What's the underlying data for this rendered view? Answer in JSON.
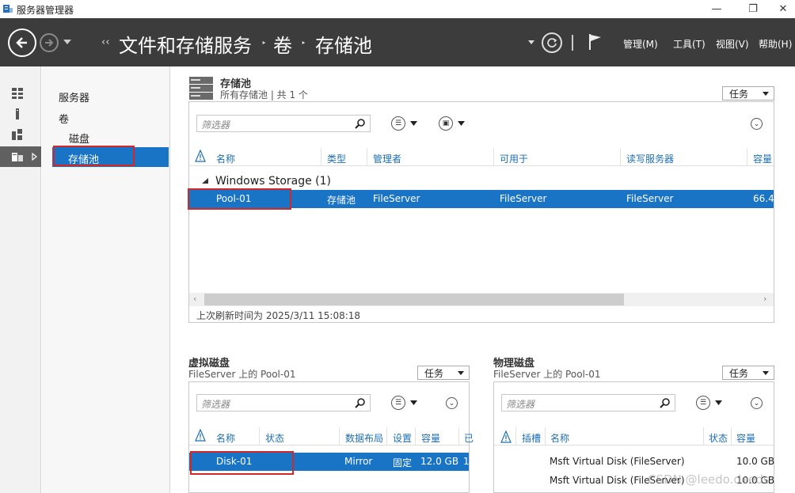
{
  "window": {
    "title": "服务器管理器",
    "minimize": "—",
    "restore": "❐",
    "close": "✕"
  },
  "header": {
    "breadcrumb_prefix": "‹‹",
    "breadcrumb": [
      "文件和存储服务",
      "卷",
      "存储池"
    ],
    "breadcrumb_sep": "‣",
    "menus": [
      "管理(M)",
      "工具(T)",
      "视图(V)",
      "帮助(H)"
    ]
  },
  "nav": {
    "items": [
      "服务器",
      "卷",
      "磁盘",
      "存储池"
    ]
  },
  "pools": {
    "title": "存储池",
    "subtitle": "所有存储池 | 共 1 个",
    "tasks": "任务",
    "filter_placeholder": "筛选器",
    "columns": [
      "名称",
      "类型",
      "管理者",
      "可用于",
      "读写服务器",
      "容量"
    ],
    "group": "Windows Storage (1)",
    "rows": [
      {
        "name": "Pool-01",
        "type": "存储池",
        "managed_by": "FileServer",
        "available_to": "FileServer",
        "rw_server": "FileServer",
        "capacity": "66.4"
      }
    ],
    "footer": "上次刷新时间为 2025/3/11 15:08:18"
  },
  "vdisks": {
    "title": "虚拟磁盘",
    "subtitle": "FileServer 上的 Pool-01",
    "tasks": "任务",
    "filter_placeholder": "筛选器",
    "columns": [
      "名称",
      "状态",
      "数据布局",
      "设置",
      "容量",
      "已"
    ],
    "rows": [
      {
        "name": "Disk-01",
        "status": "",
        "layout": "Mirror",
        "provisioning": "固定",
        "capacity": "12.0 GB",
        "extra": "1"
      }
    ]
  },
  "pdisks": {
    "title": "物理磁盘",
    "subtitle": "FileServer 上的 Pool-01",
    "tasks": "任务",
    "filter_placeholder": "筛选器",
    "columns": [
      "插槽",
      "名称",
      "状态",
      "容量"
    ],
    "rows": [
      {
        "slot": "",
        "name": "Msft Virtual Disk (FileServer)",
        "status": "",
        "capacity": "10.0 GB"
      },
      {
        "slot": "",
        "name": "Msft Virtual Disk (FileServer)",
        "status": "",
        "capacity": "10.0 GB"
      }
    ]
  },
  "watermark": "CSDN @leedo.deeds",
  "colors": {
    "accent": "#1a74c6",
    "header_bg": "#3c3c3c",
    "highlight_box": "#d42828"
  }
}
